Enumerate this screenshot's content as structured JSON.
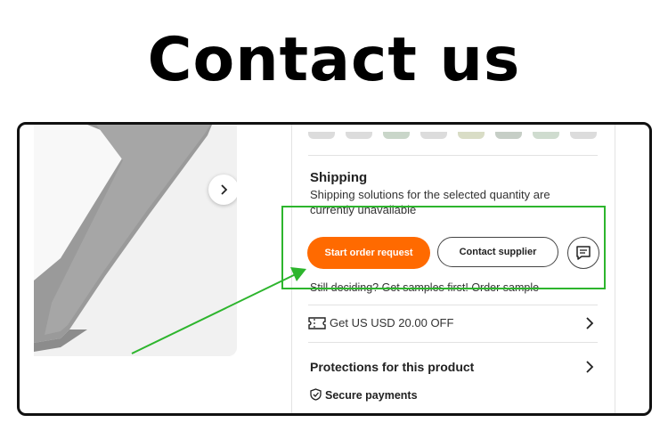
{
  "heading": "Contact us",
  "product": {
    "next_icon": "chevron-right-icon"
  },
  "shipping": {
    "title": "Shipping",
    "text": "Shipping solutions for the selected quantity are currently unavailable"
  },
  "actions": {
    "start_order": "Start order request",
    "contact_supplier": "Contact supplier",
    "chat_icon": "message-icon",
    "samples_text": "Still deciding? Get samples first! Order sample"
  },
  "coupon": {
    "text": "Get US USD 20.00 OFF",
    "icon": "ticket-icon"
  },
  "protections": {
    "title": "Protections for this product",
    "secure_payments": "Secure payments"
  },
  "colors": {
    "accent": "#ff6a00",
    "highlight": "#2db52d"
  }
}
